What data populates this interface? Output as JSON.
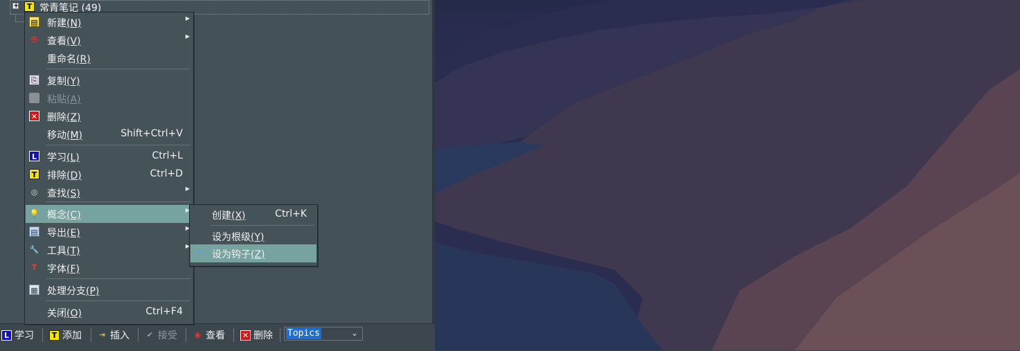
{
  "tree": {
    "root_expander": "+",
    "root_icon": "T",
    "root_label": "常青笔记 (49)"
  },
  "context_menu": {
    "items": [
      {
        "icon": "new-note-icon",
        "glyph": "▤",
        "label": "新建",
        "mnemonic": "(N)",
        "shortcut": "",
        "submenu": true,
        "disabled": false
      },
      {
        "icon": "view-eye-icon",
        "glyph": "👁",
        "label": "查看",
        "mnemonic": "(V)",
        "shortcut": "",
        "submenu": true,
        "disabled": false
      },
      {
        "icon": "",
        "glyph": "",
        "label": "重命名",
        "mnemonic": "(R)",
        "shortcut": "",
        "submenu": false,
        "disabled": false
      },
      {
        "icon": "copy-icon",
        "glyph": "⎘",
        "label": "复制",
        "mnemonic": "(Y)",
        "shortcut": "",
        "submenu": false,
        "disabled": false
      },
      {
        "icon": "paste-icon",
        "glyph": "",
        "label": "粘贴",
        "mnemonic": "(A)",
        "shortcut": "",
        "submenu": false,
        "disabled": true
      },
      {
        "icon": "delete-icon",
        "glyph": "✕",
        "label": "删除",
        "mnemonic": "(Z)",
        "shortcut": "",
        "submenu": false,
        "disabled": false
      },
      {
        "icon": "",
        "glyph": "",
        "label": "移动",
        "mnemonic": "(M)",
        "shortcut": "Shift+Ctrl+V",
        "submenu": false,
        "disabled": false
      },
      {
        "icon": "learn-L-icon",
        "glyph": "L",
        "label": "学习",
        "mnemonic": "(L)",
        "shortcut": "Ctrl+L",
        "submenu": false,
        "disabled": false
      },
      {
        "icon": "dismiss-T-icon",
        "glyph": "T",
        "label": "排除",
        "mnemonic": "(D)",
        "shortcut": "Ctrl+D",
        "submenu": false,
        "disabled": false
      },
      {
        "icon": "binoculars-icon",
        "glyph": "◎",
        "label": "查找",
        "mnemonic": "(S)",
        "shortcut": "",
        "submenu": true,
        "disabled": false
      },
      {
        "icon": "lightbulb-icon",
        "glyph": "💡",
        "label": "概念",
        "mnemonic": "(C)",
        "shortcut": "",
        "submenu": true,
        "disabled": false
      },
      {
        "icon": "export-icon",
        "glyph": "▤",
        "label": "导出",
        "mnemonic": "(E)",
        "shortcut": "",
        "submenu": true,
        "disabled": false
      },
      {
        "icon": "wrench-icon",
        "glyph": "🔧",
        "label": "工具",
        "mnemonic": "(T)",
        "shortcut": "",
        "submenu": true,
        "disabled": false
      },
      {
        "icon": "font-icon",
        "glyph": "T",
        "label": "字体",
        "mnemonic": "(F)",
        "shortcut": "",
        "submenu": false,
        "disabled": false
      },
      {
        "icon": "branch-icon",
        "glyph": "▦",
        "label": "处理分支",
        "mnemonic": "(P)",
        "shortcut": "",
        "submenu": false,
        "disabled": false
      },
      {
        "icon": "",
        "glyph": "",
        "label": "关闭",
        "mnemonic": "(O)",
        "shortcut": "Ctrl+F4",
        "submenu": false,
        "disabled": false
      }
    ]
  },
  "concept_submenu": {
    "items": [
      {
        "icon": "",
        "glyph": "",
        "label": "创建",
        "mnemonic": "(X)",
        "shortcut": "Ctrl+K"
      },
      {
        "icon": "",
        "glyph": "",
        "label": "设为根级",
        "mnemonic": "(Y)",
        "shortcut": ""
      },
      {
        "icon": "hook-icon",
        "glyph": "↺",
        "label": "设为钩子",
        "mnemonic": "(Z)",
        "shortcut": ""
      }
    ]
  },
  "toolbar": {
    "learn_icon": "L",
    "learn_label": "学习",
    "add_icon": "T",
    "add_label": "添加",
    "insert_label": "插入",
    "accept_label": "接受",
    "view_label": "查看",
    "delete_label": "删除",
    "topics_value": "Topics"
  }
}
